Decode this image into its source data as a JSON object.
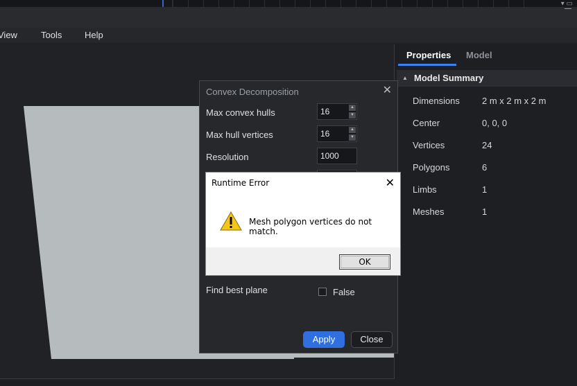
{
  "menu": [
    "View",
    "Tools",
    "Help"
  ],
  "panel": {
    "tabs": [
      "Properties",
      "Model"
    ],
    "summary_title": "Model Summary",
    "rows": [
      {
        "key": "Dimensions",
        "value": "2 m x 2 m x 2 m"
      },
      {
        "key": "Center",
        "value": "0, 0, 0"
      },
      {
        "key": "Vertices",
        "value": "24"
      },
      {
        "key": "Polygons",
        "value": "6"
      },
      {
        "key": "Limbs",
        "value": "1"
      },
      {
        "key": "Meshes",
        "value": "1"
      }
    ]
  },
  "convex": {
    "title": "Convex Decomposition",
    "max_hulls_label": "Max convex hulls",
    "max_hulls_value": "16",
    "max_vertices_label": "Max hull vertices",
    "max_vertices_value": "16",
    "resolution_label": "Resolution",
    "resolution_value": "1000",
    "find_plane_label": "Find best plane",
    "find_plane_value": "False",
    "apply_label": "Apply",
    "close_label": "Close"
  },
  "error": {
    "title": "Runtime Error",
    "message": "Mesh polygon vertices do not match.",
    "ok_label": "OK"
  },
  "colors": {
    "accent": "#2f6fe0",
    "shape_fill": "#b6bcbd"
  }
}
